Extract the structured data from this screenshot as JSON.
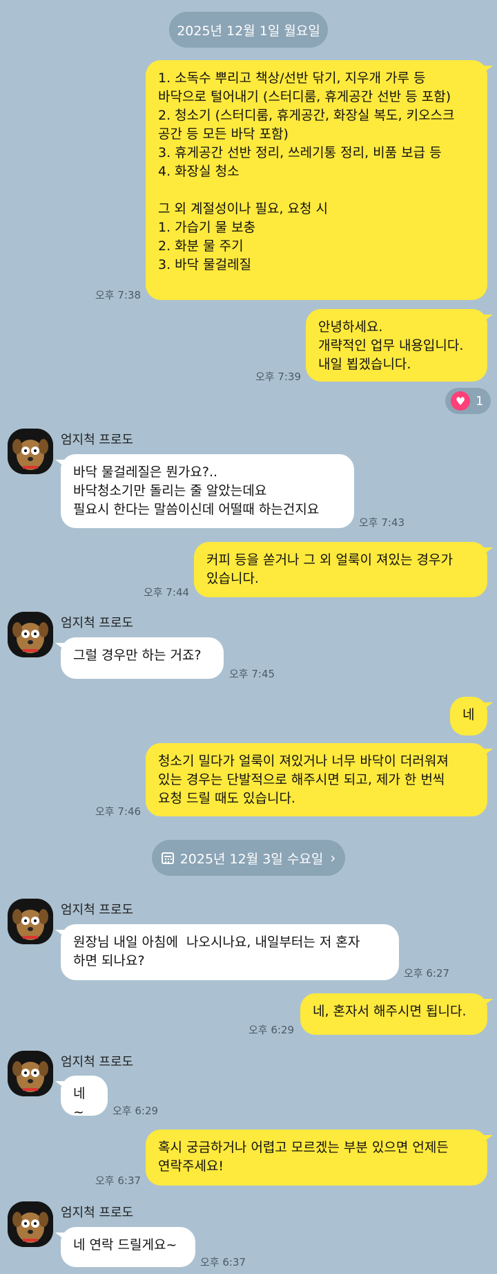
{
  "date_separators": [
    {
      "label": "2025년 12월 1일 월요일"
    },
    {
      "label": "2025년 12월 3일 수요일"
    }
  ],
  "contact": {
    "name": "엄지척 프로도"
  },
  "messages": [
    {
      "from": "me",
      "text": "1. 소독수 뿌리고 책상/선반 닦기, 지우개 가루 등\n바닥으로 털어내기 (스터디룸, 휴게공간 선반 등 포함)\n2. 청소기 (스터디룸, 휴게공간, 화장실 복도, 키오스크\n공간 등 모든 바닥 포함)\n3. 휴게공간 선반 정리, 쓰레기통 정리, 비품 보급 등\n4. 화장실 청소\n\n그 외 계절성이나 필요, 요청 시\n1. 가습기 물 보충\n2. 화분 물 주기\n3. 바닥 물걸레질",
      "time": "오후 7:38"
    },
    {
      "from": "me",
      "text": "안녕하세요.\n개략적인 업무 내용입니다.\n내일 뵙겠습니다.",
      "time": "오후 7:39",
      "reaction_count": "1"
    },
    {
      "from": "other",
      "text": "바닥 물걸레질은 뭔가요?..\n바닥청소기만 돌리는 줄 알았는데요\n필요시 한다는 말씀이신데 어떨때 하는건지요",
      "time": "오후 7:43"
    },
    {
      "from": "me",
      "text": "커피 등을 쏟거나 그 외 얼룩이 져있는 경우가\n있습니다.",
      "time": "오후 7:44"
    },
    {
      "from": "other",
      "text": "그럴 경우만 하는 거죠?",
      "time": "오후 7:45"
    },
    {
      "from": "me",
      "text": "네",
      "time": ""
    },
    {
      "from": "me",
      "text": "청소기 밀다가 얼룩이 져있거나 너무 바닥이 더러워져\n있는 경우는 단발적으로 해주시면 되고, 제가 한 번씩\n요청 드릴 때도 있습니다.",
      "time": "오후 7:46"
    },
    {
      "from": "other",
      "text": "원장님 내일 아침에  나오시나요, 내일부터는 저 혼자\n하면 되나요?",
      "time": "오후 6:27"
    },
    {
      "from": "me",
      "text": "네, 혼자서 해주시면 됩니다.",
      "time": "오후 6:29"
    },
    {
      "from": "other",
      "text": "네~",
      "time": "오후 6:29"
    },
    {
      "from": "me",
      "text": "혹시 궁금하거나 어렵고 모르겠는 부분 있으면 언제든\n연락주세요!",
      "time": "오후 6:37"
    },
    {
      "from": "other",
      "text": "네 연락 드릴게요~",
      "time": "오후 6:37"
    }
  ],
  "colors": {
    "background": "#abc1d1",
    "my_bubble": "#fee93d",
    "other_bubble": "#ffffff",
    "date_pill": "#8ba4b6",
    "heart": "#ff3f78"
  },
  "icons": {
    "avatar": "dog-character-avatar",
    "calendar": "calendar-icon",
    "chevron": "chevron-right-icon",
    "reaction": "heart-icon"
  }
}
